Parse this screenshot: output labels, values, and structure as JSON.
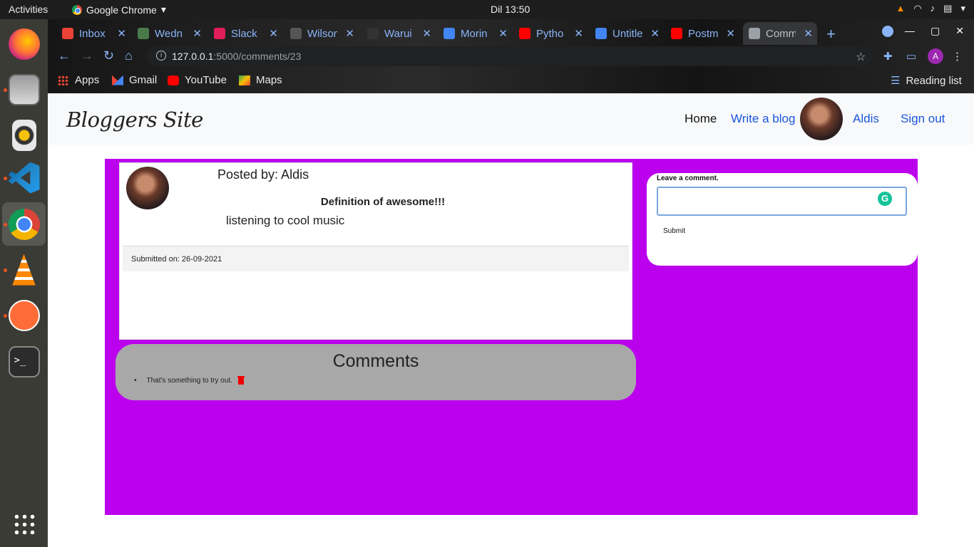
{
  "system": {
    "activities": "Activities",
    "app_name": "Google Chrome",
    "clock": "Dil 13:50"
  },
  "dock": {
    "items": [
      "firefox-icon",
      "files-icon",
      "rhythmbox-icon",
      "vscode-icon",
      "chrome-icon",
      "vlc-icon",
      "postman-icon",
      "terminal-icon",
      "apps-grid-icon"
    ]
  },
  "browser": {
    "tabs": [
      {
        "label": "Inbox",
        "color": "#ea4335"
      },
      {
        "label": "Wedn",
        "color": "#4a7a4a"
      },
      {
        "label": "Slack |",
        "color": "#e01e5a"
      },
      {
        "label": "Wilson",
        "color": "#555555"
      },
      {
        "label": "Warui",
        "color": "#333333"
      },
      {
        "label": "Morin",
        "color": "#4285f4"
      },
      {
        "label": "Pytho",
        "color": "#ff0000"
      },
      {
        "label": "Untitle",
        "color": "#4285f4"
      },
      {
        "label": "Postm",
        "color": "#ff0000"
      },
      {
        "label": "Comm",
        "color": "#9aa0a6"
      }
    ],
    "url_host": "127.0.0.1",
    "url_path": ":5000/comments/23",
    "profile_initial": "A",
    "bookmarks": [
      {
        "label": "Apps",
        "color": "#ea4335"
      },
      {
        "label": "Gmail",
        "color": "#ea4335"
      },
      {
        "label": "YouTube",
        "color": "#ff0000"
      },
      {
        "label": "Maps",
        "color": "#34a853"
      }
    ],
    "reading_list": "Reading list"
  },
  "site": {
    "brand": "Bloggers Site",
    "nav": {
      "home": "Home",
      "write": "Write a blog",
      "user": "Aldis",
      "signout": "Sign out"
    },
    "post": {
      "posted_by": "Posted by: Aldis",
      "title": "Definition of awesome!!!",
      "body": "listening to cool music",
      "submitted": "Submitted on: 26-09-2021"
    },
    "comments": {
      "title": "Comments",
      "items": [
        "That's something to try out."
      ]
    },
    "form": {
      "label": "Leave a comment.",
      "submit": "Submit"
    },
    "accent_color": "#bb00ee"
  }
}
